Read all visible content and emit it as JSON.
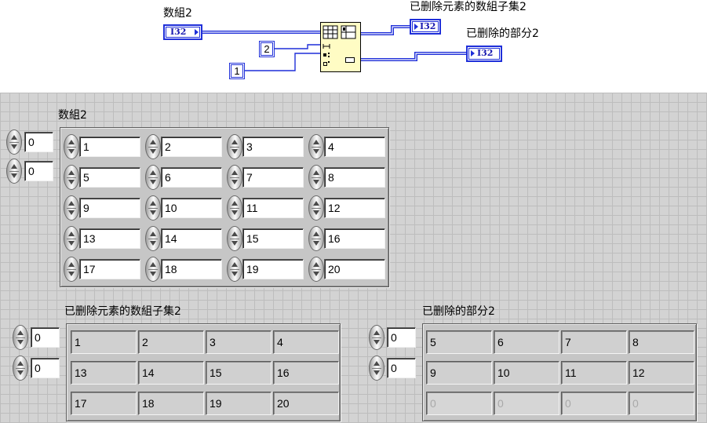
{
  "diagram": {
    "input": {
      "label": "数組2",
      "terminal": "I32"
    },
    "constants": {
      "length": "2",
      "index": "1"
    },
    "output_subset": {
      "label": "已删除元素的数組子集2",
      "terminal": "I32"
    },
    "output_deleted": {
      "label": "已删除的部分2",
      "terminal": "I32"
    },
    "node_icon": "delete-from-array-icon"
  },
  "panel": {
    "input_array": {
      "label": "数組2",
      "indices": [
        "0",
        "0"
      ],
      "rows": [
        [
          "1",
          "2",
          "3",
          "4"
        ],
        [
          "5",
          "6",
          "7",
          "8"
        ],
        [
          "9",
          "10",
          "11",
          "12"
        ],
        [
          "13",
          "14",
          "15",
          "16"
        ],
        [
          "17",
          "18",
          "19",
          "20"
        ]
      ]
    },
    "subset_array": {
      "label": "已删除元素的数組子集2",
      "indices": [
        "0",
        "0"
      ],
      "rows": [
        [
          "1",
          "2",
          "3",
          "4"
        ],
        [
          "13",
          "14",
          "15",
          "16"
        ],
        [
          "17",
          "18",
          "19",
          "20"
        ]
      ],
      "row_dimmed": [
        false,
        false,
        false
      ]
    },
    "deleted_array": {
      "label": "已删除的部分2",
      "indices": [
        "0",
        "0"
      ],
      "rows": [
        [
          "5",
          "6",
          "7",
          "8"
        ],
        [
          "9",
          "10",
          "11",
          "12"
        ],
        [
          "0",
          "0",
          "0",
          "0"
        ]
      ],
      "row_dimmed": [
        false,
        false,
        true
      ]
    }
  },
  "colors": {
    "wire": "#1f2fd9",
    "panel": "#d3d3d3",
    "node": "#fffcc4"
  }
}
